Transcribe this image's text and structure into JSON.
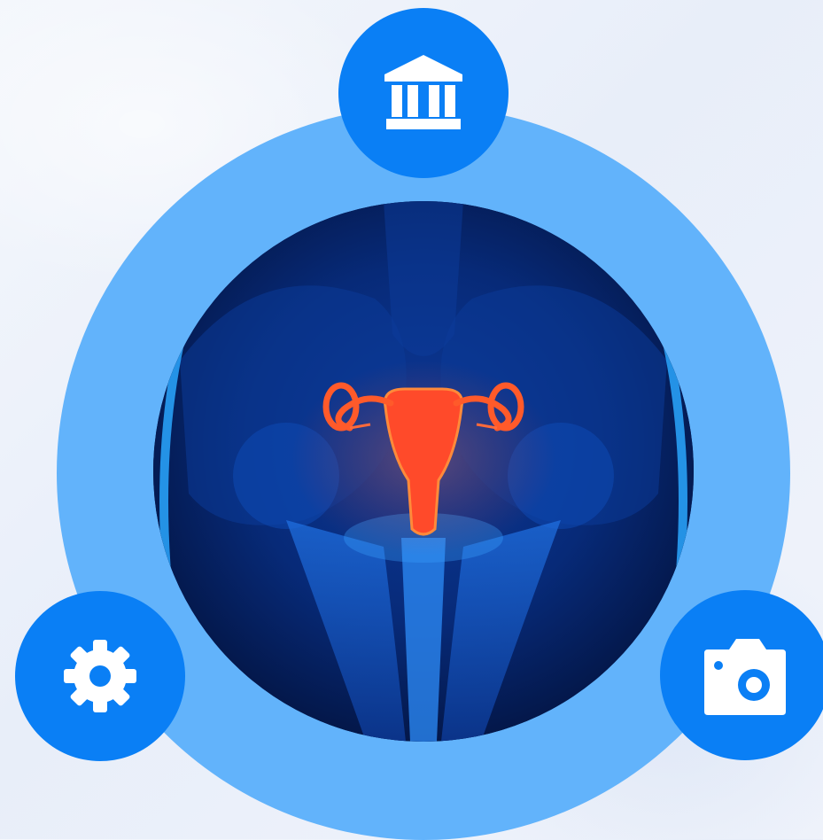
{
  "illustration": {
    "subject": "female-reproductive-anatomy",
    "ring_color": "#62b3fb",
    "node_color": "#0a7ff5",
    "organ_color": "#ff4a2a",
    "background_color": "#071a4d"
  },
  "nodes": [
    {
      "id": "top",
      "icon": "institution-icon"
    },
    {
      "id": "left",
      "icon": "gear-icon"
    },
    {
      "id": "right",
      "icon": "camera-icon"
    }
  ]
}
